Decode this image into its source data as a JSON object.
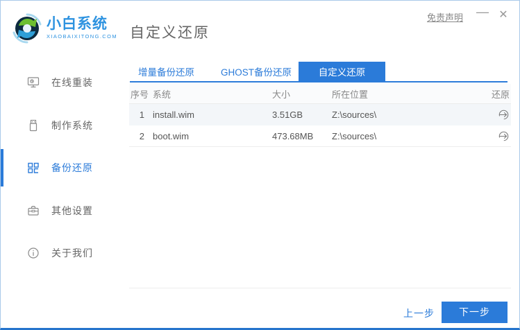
{
  "window": {
    "brand": {
      "name": "小白系统",
      "domain": "XIAOBAIXITONG.COM"
    },
    "title": "自定义还原",
    "titlebar": {
      "disclaimer": "免责声明",
      "minimize": "—",
      "close": "✕"
    }
  },
  "sidebar": {
    "items": [
      {
        "label": "在线重装",
        "icon": "monitor-icon",
        "active": false
      },
      {
        "label": "制作系统",
        "icon": "usb-drive-icon",
        "active": false
      },
      {
        "label": "备份还原",
        "icon": "grid-blocks-icon",
        "active": true
      },
      {
        "label": "其他设置",
        "icon": "toolbox-icon",
        "active": false
      },
      {
        "label": "关于我们",
        "icon": "info-icon",
        "active": false
      }
    ]
  },
  "tabs": [
    {
      "label": "增量备份还原",
      "active": false
    },
    {
      "label": "GHOST备份还原",
      "active": false
    },
    {
      "label": "自定义还原",
      "active": true
    }
  ],
  "table": {
    "headers": [
      "序号",
      "系统",
      "大小",
      "所在位置",
      "还原"
    ],
    "rows": [
      {
        "index": "1",
        "system": "install.wim",
        "size": "3.51GB",
        "location": "Z:\\sources\\",
        "action_icon": "restore-icon"
      },
      {
        "index": "2",
        "system": "boot.wim",
        "size": "473.68MB",
        "location": "Z:\\sources\\",
        "action_icon": "restore-icon"
      }
    ]
  },
  "footer": {
    "prev_label": "上一步",
    "next_label": "下一步"
  },
  "colors": {
    "accent": "#2b7bd9",
    "brand_blue": "#2e93e0",
    "bottom_border": "#2574cc",
    "alt_row_bg": "#f3f6f9",
    "text_gray": "#666"
  }
}
